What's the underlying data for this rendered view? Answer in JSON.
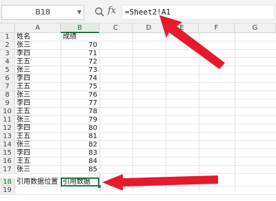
{
  "name_box": {
    "value": "B18"
  },
  "formula_bar": {
    "fx_label": "fx",
    "formula": "=Sheet2!A1"
  },
  "columns": [
    "A",
    "B",
    "C",
    "D",
    "E",
    "F",
    "G"
  ],
  "rows": [
    {
      "num": "1",
      "a": "姓名",
      "b": "成绩"
    },
    {
      "num": "2",
      "a": "张三",
      "b": "70"
    },
    {
      "num": "3",
      "a": "李四",
      "b": "71"
    },
    {
      "num": "4",
      "a": "王五",
      "b": "72"
    },
    {
      "num": "5",
      "a": "张三",
      "b": "73"
    },
    {
      "num": "6",
      "a": "李四",
      "b": "74"
    },
    {
      "num": "7",
      "a": "王五",
      "b": "75"
    },
    {
      "num": "8",
      "a": "张三",
      "b": "76"
    },
    {
      "num": "9",
      "a": "李四",
      "b": "77"
    },
    {
      "num": "10",
      "a": "王五",
      "b": "78"
    },
    {
      "num": "11",
      "a": "张三",
      "b": "79"
    },
    {
      "num": "12",
      "a": "李四",
      "b": "80"
    },
    {
      "num": "13",
      "a": "王五",
      "b": "81"
    },
    {
      "num": "14",
      "a": "张三",
      "b": "82"
    },
    {
      "num": "15",
      "a": "李四",
      "b": "83"
    },
    {
      "num": "16",
      "a": "王五",
      "b": "84"
    },
    {
      "num": "17",
      "a": "张三",
      "b": "85"
    },
    {
      "num": "18",
      "a": "引用数据位置",
      "b": "引用数据"
    },
    {
      "num": "19",
      "a": "",
      "b": ""
    }
  ],
  "active_cell": "B18",
  "colors": {
    "accent": "#217346",
    "arrow": "#e8192c"
  }
}
